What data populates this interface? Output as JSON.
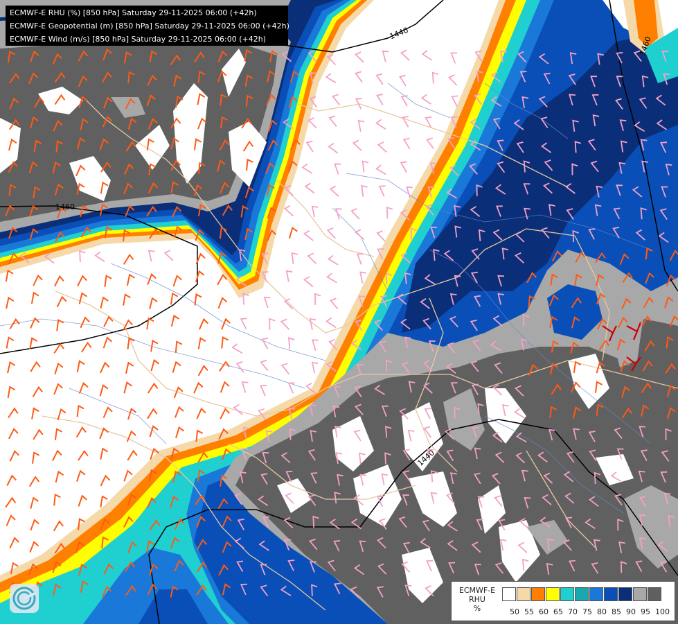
{
  "header": {
    "lines": [
      "ECMWF-E RHU (%) [850 hPa] Saturday 29-11-2025 06:00 (+42h)",
      "ECMWF-E Geopotential (m) [850 hPa] Saturday 29-11-2025 06:00 (+42h)",
      "ECMWF-E Wind (m/s) [850 hPa] Saturday 29-11-2025 06:00 (+42h)"
    ]
  },
  "map": {
    "contour_labels": [
      "1440",
      "1460",
      "1460",
      "1440"
    ]
  },
  "legend": {
    "name_lines": [
      "ECMWF-E",
      "RHU",
      "%"
    ],
    "ticks": [
      "50",
      "55",
      "60",
      "65",
      "70",
      "75",
      "80",
      "85",
      "90",
      "95",
      "100"
    ],
    "colors": [
      "#ffffff",
      "#f5d9a8",
      "#ff8000",
      "#ffff00",
      "#20d0d0",
      "#1aa8b0",
      "#1a78d8",
      "#0a4fb8",
      "#0a2f78",
      "#a8a8a8",
      "#606060"
    ]
  },
  "logo": {
    "icon": "ecmwf-logo-icon"
  },
  "colors": {
    "wind_dry": "#ff5a14",
    "wind_moist": "#f5a0c8",
    "border": "#e8c8a0",
    "river": "#6688cc",
    "contour": "#000000"
  }
}
